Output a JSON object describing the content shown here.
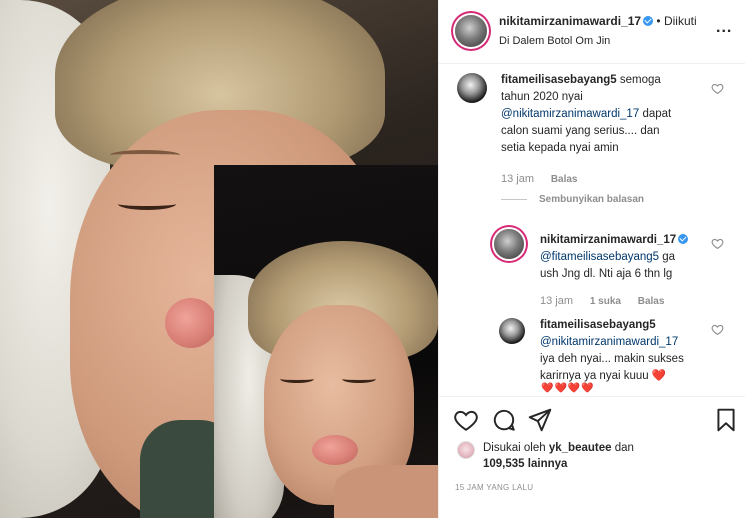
{
  "header": {
    "username": "nikitamirzanimawardi_17",
    "follow_status": "• Diikuti",
    "location": "Di Dalem Botol Om Jin",
    "more_label": "..."
  },
  "comments": [
    {
      "username": "fitameilisasebayang5",
      "text_lines": [
        "semoga",
        "tahun 2020 nyai",
        "@nikitamirzanimawardi_17 dapat",
        "calon suami yang serius.... dan",
        "setia kepada nyai amin"
      ],
      "time": "13 jam",
      "reply_label": "Balas",
      "hide_replies": "Sembunyikan balasan"
    },
    {
      "username": "nikitamirzanimawardi_17",
      "text_lines": [
        "@fitameilisasebayang5 ga",
        "ush Jng dl. Nti aja 6 thn lg"
      ],
      "time": "13 jam",
      "likes": "1 suka",
      "reply_label": "Balas"
    },
    {
      "username": "fitameilisasebayang5",
      "text_lines": [
        "@nikitamirzanimawardi_17",
        "iya deh nyai... makin sukses",
        "karirnya ya nyai kuuu ❤️"
      ],
      "emojis": "❤️❤️❤️❤️"
    }
  ],
  "likes": {
    "prefix": "Disukai oleh",
    "user": "yk_beautee",
    "connector": "dan",
    "count": "109,535",
    "suffix": "lainnya"
  },
  "timestamp": "15 JAM YANG LALU",
  "icons": [
    "heart-icon",
    "comment-icon",
    "share-icon",
    "bookmark-icon"
  ]
}
